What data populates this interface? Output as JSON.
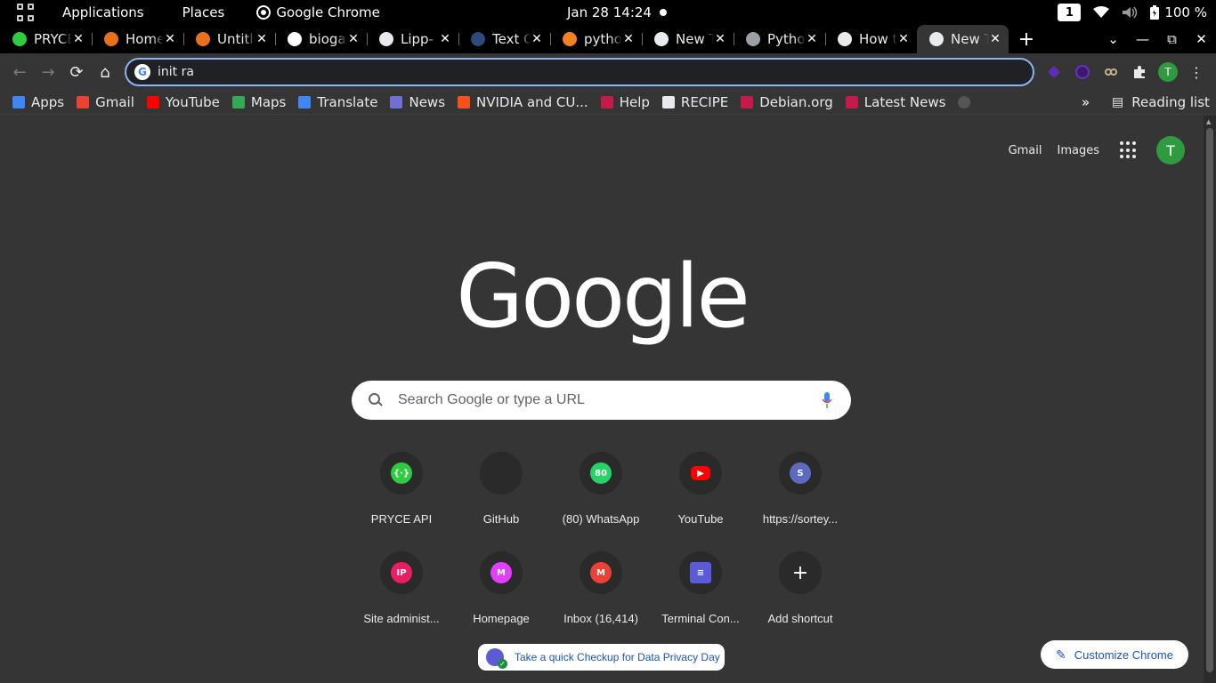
{
  "system_bar": {
    "menu": [
      "Applications",
      "Places"
    ],
    "active_app": "Google Chrome",
    "clock": "Jan 28  14:24",
    "workspace": "1",
    "battery": "100 %"
  },
  "tabs": [
    {
      "title": "PRYCE API",
      "favicon_color": "#2ecc40",
      "favicon": "globe-icon"
    },
    {
      "title": "Home",
      "favicon_color": "#e8711c",
      "favicon": "ring-icon"
    },
    {
      "title": "Untitled",
      "favicon_color": "#e8711c",
      "favicon": "notebook-icon"
    },
    {
      "title": "biogas",
      "favicon_color": "#ffffff",
      "favicon": "google-icon"
    },
    {
      "title": "Lipp-",
      "favicon_color": "#e8eaed",
      "favicon": "globe-icon"
    },
    {
      "title": "Text C",
      "favicon_color": "#2d4a7a",
      "favicon": "tds-icon"
    },
    {
      "title": "python",
      "favicon_color": "#f48024",
      "favicon": "stackoverflow-icon"
    },
    {
      "title": "New Tab",
      "favicon_color": "#e8eaed",
      "favicon": "chrome-icon"
    },
    {
      "title": "Python",
      "favicon_color": "#9aa0a6",
      "favicon": "python-icon"
    },
    {
      "title": "How to",
      "favicon_color": "#e8eaed",
      "favicon": "globe-icon"
    },
    {
      "title": "New Tab",
      "favicon_color": "#e8eaed",
      "favicon": "chrome-icon",
      "active": true
    }
  ],
  "omnibox": {
    "value": "init ra"
  },
  "bookmarks": [
    {
      "label": "Apps",
      "color": "#4285f4"
    },
    {
      "label": "Gmail",
      "color": "#ea4335"
    },
    {
      "label": "YouTube",
      "color": "#ff0000"
    },
    {
      "label": "Maps",
      "color": "#34a853"
    },
    {
      "label": "Translate",
      "color": "#4285f4"
    },
    {
      "label": "News",
      "color": "#6f6fd4"
    },
    {
      "label": "NVIDIA and CU...",
      "color": "#f4511e"
    },
    {
      "label": "Help",
      "color": "#c51a4a"
    },
    {
      "label": "RECIPE",
      "color": "#e8eaed"
    },
    {
      "label": "Debian.org",
      "color": "#c51a4a"
    },
    {
      "label": "Latest News",
      "color": "#c51a4a"
    }
  ],
  "reading_list": "Reading list",
  "top_links": {
    "gmail": "Gmail",
    "images": "Images",
    "avatar_letter": "T"
  },
  "logo": "Google",
  "search": {
    "placeholder": "Search Google or type a URL"
  },
  "shortcuts": [
    {
      "label": "PRYCE API",
      "color": "#2ecc40",
      "glyph": "{·}"
    },
    {
      "label": "GitHub",
      "color": "#2a2a2a",
      "glyph": ""
    },
    {
      "label": "(80) WhatsApp",
      "color": "#25d366",
      "glyph": "80"
    },
    {
      "label": "YouTube",
      "color": "#ff0000",
      "glyph": "▶"
    },
    {
      "label": "https://sortey...",
      "color": "#5c6bc0",
      "glyph": "S"
    },
    {
      "label": "Site administ...",
      "color": "#e91e63",
      "glyph": "IP"
    },
    {
      "label": "Homepage",
      "color": "#e040fb",
      "glyph": "M"
    },
    {
      "label": "Inbox (16,414)",
      "color": "#ea4335",
      "glyph": "M"
    },
    {
      "label": "Terminal Con...",
      "color": "#5b5bd6",
      "glyph": "≡"
    },
    {
      "label": "Add shortcut",
      "color": "#3c3c3c",
      "glyph": "+"
    }
  ],
  "privacy_chip": "Take a quick Checkup for Data Privacy Day",
  "customize": "Customize Chrome"
}
